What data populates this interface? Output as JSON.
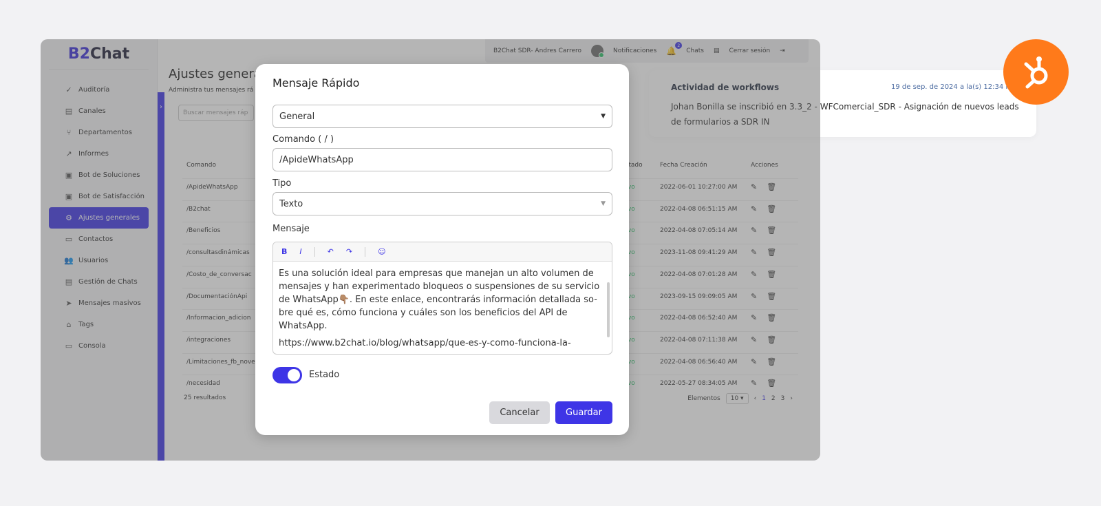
{
  "app": {
    "logo_prefix": "B2",
    "logo_suffix": "Chat",
    "page_title": "Ajustes genera",
    "page_subtitle": "Administra tus mensajes rá",
    "search_placeholder": "Buscar mensajes ráp"
  },
  "sidebar": {
    "items": [
      {
        "label": "Auditoría",
        "icon": "check-circle-icon"
      },
      {
        "label": "Canales",
        "icon": "chat-bubbles-icon"
      },
      {
        "label": "Departamentos",
        "icon": "fork-icon"
      },
      {
        "label": "Informes",
        "icon": "trend-icon"
      },
      {
        "label": "Bot de Soluciones",
        "icon": "bot-icon"
      },
      {
        "label": "Bot de Satisfacción",
        "icon": "bot-icon"
      },
      {
        "label": "Ajustes generales",
        "icon": "gear-icon"
      },
      {
        "label": "Contactos",
        "icon": "contact-card-icon"
      },
      {
        "label": "Usuarios",
        "icon": "users-icon"
      },
      {
        "label": "Gestión de Chats",
        "icon": "chat-bubbles-icon"
      },
      {
        "label": "Mensajes masivos",
        "icon": "send-icon"
      },
      {
        "label": "Tags",
        "icon": "tag-icon"
      },
      {
        "label": "Consola",
        "icon": "monitor-icon"
      }
    ],
    "active_index": 6
  },
  "topbar": {
    "user": "B2Chat SDR- Andres Carrero",
    "notifications": "Notificaciones",
    "notif_count": "2",
    "chats": "Chats",
    "logout": "Cerrar sesión"
  },
  "table": {
    "headers": {
      "command": "Comando",
      "status": "Estado",
      "date": "Fecha Creación",
      "actions": "Acciones"
    },
    "rows": [
      {
        "command": "/ApideWhatsApp",
        "status": "Activo",
        "date": "2022-06-01 10:27:00 AM"
      },
      {
        "command": "/B2chat",
        "status": "Activo",
        "date": "2022-04-08 06:51:15 AM"
      },
      {
        "command": "/Beneficios",
        "status": "Activo",
        "date": "2022-04-08 07:05:14 AM"
      },
      {
        "command": "/consultasdinámicas",
        "status": "Activo",
        "date": "2023-11-08 09:41:29 AM"
      },
      {
        "command": "/Costo_de_conversac",
        "status": "Activo",
        "date": "2022-04-08 07:01:28 AM"
      },
      {
        "command": "/DocumentaciónApi",
        "status": "Activo",
        "date": "2023-09-15 09:09:05 AM"
      },
      {
        "command": "/Informacion_adicion",
        "status": "Activo",
        "date": "2022-04-08 06:52:40 AM"
      },
      {
        "command": "/integraciones",
        "status": "Activo",
        "date": "2022-04-08 07:11:38 AM"
      },
      {
        "command": "/Limitaciones_fb_nove",
        "status": "Activo",
        "date": "2022-04-08 06:56:40 AM"
      },
      {
        "command": "/necesidad",
        "status": "Activo",
        "date": "2022-05-27 08:34:05 AM"
      }
    ],
    "results": "25 resultados",
    "pager": {
      "label": "Elementos",
      "page_size": "10",
      "pages": [
        "1",
        "2",
        "3"
      ],
      "current": "1"
    }
  },
  "modal": {
    "title": "Mensaje Rápido",
    "category": "General",
    "command_label": "Comando ( / )",
    "command_value": "/ApideWhatsApp",
    "type_label": "Tipo",
    "type_value": "Texto",
    "message_label": "Mensaje",
    "message_p1": "Es una solución ideal para empresas que manejan un alto volumen de mensajes y han experimentado bloqueos o suspensiones de su servicio de WhatsApp👇🏽. En este enlace, encontrarás información detallada so-bre qué es, cómo funciona y cuáles son los beneficios del API de WhatsApp.",
    "message_p2": "https://www.b2chat.io/blog/whatsapp/que-es-y-como-funciona-la-",
    "status_label": "Estado",
    "status_on": true,
    "cancel": "Cancelar",
    "save": "Guardar"
  },
  "notification": {
    "title": "Actividad de workflows",
    "time": "19 de sep. de 2024 a la(s) 12:34 PM",
    "body": "Johan Bonilla se inscribió en 3.3_2 - WFComercial_SDR - Asignación de nuevos leads de formularios a SDR IN"
  },
  "colors": {
    "accent": "#3e35e6",
    "hubspot": "#ff7a1a",
    "active_green": "#2ec26b"
  }
}
